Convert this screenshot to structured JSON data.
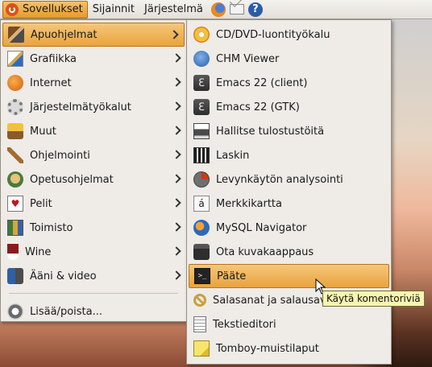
{
  "top_panel": {
    "applications_menu": "Sovellukset",
    "places_menu": "Sijainnit",
    "system_menu": "Järjestelmä",
    "launchers": [
      {
        "icon": "firefox-icon"
      },
      {
        "icon": "mail-icon"
      },
      {
        "icon": "help-icon",
        "glyph": "?"
      }
    ]
  },
  "applications_menu": {
    "items": [
      {
        "label": "Apuohjelmat",
        "icon": "accessories-icon",
        "submenu": true,
        "selected": true
      },
      {
        "label": "Grafiikka",
        "icon": "graphics-icon",
        "submenu": true
      },
      {
        "label": "Internet",
        "icon": "internet-icon",
        "submenu": true
      },
      {
        "label": "Järjestelmätyökalut",
        "icon": "system-tools-icon",
        "submenu": true
      },
      {
        "label": "Muut",
        "icon": "other-icon",
        "submenu": true
      },
      {
        "label": "Ohjelmointi",
        "icon": "programming-icon",
        "submenu": true
      },
      {
        "label": "Opetusohjelmat",
        "icon": "education-icon",
        "submenu": true
      },
      {
        "label": "Pelit",
        "icon": "games-icon",
        "submenu": true,
        "glyph": "♥"
      },
      {
        "label": "Toimisto",
        "icon": "office-icon",
        "submenu": true
      },
      {
        "label": "Wine",
        "icon": "wine-icon",
        "submenu": true
      },
      {
        "label": "Ääni & video",
        "icon": "sound-video-icon",
        "submenu": true
      }
    ],
    "bottom_item": {
      "label": "Lisää/poista...",
      "icon": "add-remove-icon"
    }
  },
  "accessories_submenu": {
    "items": [
      {
        "label": "CD/DVD-luontityökalu",
        "icon": "cd-dvd-icon"
      },
      {
        "label": "CHM Viewer",
        "icon": "chm-viewer-icon"
      },
      {
        "label": "Emacs 22 (client)",
        "icon": "emacs-icon",
        "glyph": "ℇ"
      },
      {
        "label": "Emacs 22 (GTK)",
        "icon": "emacs-icon",
        "glyph": "ℇ"
      },
      {
        "label": "Hallitse tulostustöitä",
        "icon": "printer-icon"
      },
      {
        "label": "Laskin",
        "icon": "calculator-icon"
      },
      {
        "label": "Levynkäytön analysointi",
        "icon": "disk-usage-icon"
      },
      {
        "label": "Merkkikartta",
        "icon": "character-map-icon",
        "glyph": "á"
      },
      {
        "label": "MySQL Navigator",
        "icon": "mysql-navigator-icon"
      },
      {
        "label": "Ota kuvakaappaus",
        "icon": "screenshot-icon"
      },
      {
        "label": "Pääte",
        "icon": "terminal-icon",
        "glyph": ">_",
        "highlighted": true
      },
      {
        "label": "Salasanat ja salausavaimet",
        "icon": "passwords-keys-icon"
      },
      {
        "label": "Tekstieditori",
        "icon": "text-editor-icon"
      },
      {
        "label": "Tomboy-muistilaput",
        "icon": "tomboy-icon"
      }
    ]
  },
  "tooltip": {
    "text": "Käytä komentoriviä"
  },
  "colors": {
    "highlight": "#e9a33c",
    "menu_background": "#efebe7",
    "tooltip_background": "#f6f4ae"
  }
}
